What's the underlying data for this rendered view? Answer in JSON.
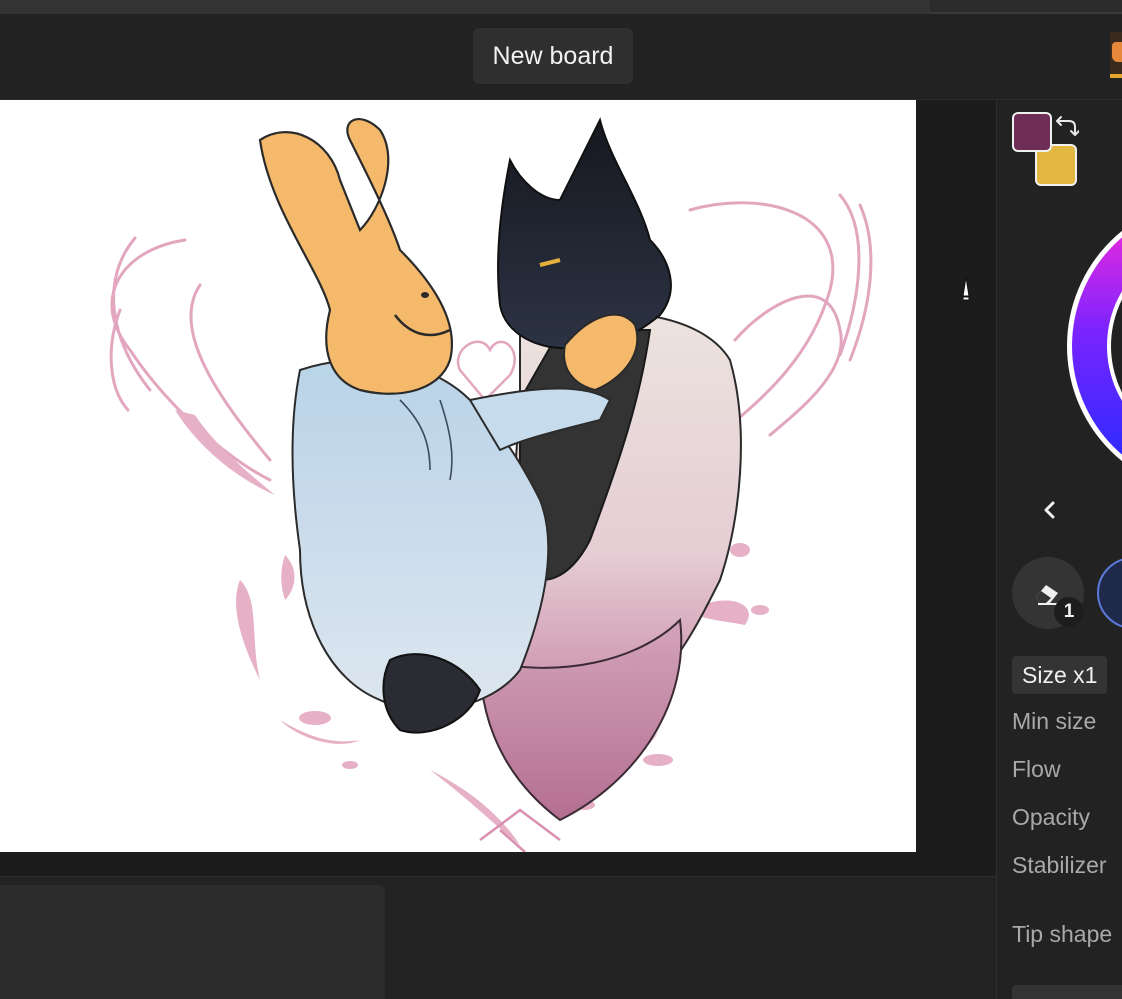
{
  "header": {
    "new_board_label": "New board"
  },
  "colors": {
    "primary": "#6e2e55",
    "secondary": "#e2b840",
    "accent": "#5b79d9"
  },
  "tools": {
    "eraser_badge": "1"
  },
  "brush_settings": {
    "size_label": "Size x1",
    "min_size_label": "Min size",
    "flow_label": "Flow",
    "opacity_label": "Opacity",
    "stabilizer_label": "Stabilizer",
    "tip_shape_label": "Tip shape"
  },
  "icons": {
    "swap": "swap-colors-icon",
    "chevron": "chevron-left-icon",
    "eraser": "eraser-icon",
    "cursor": "brush-cursor-icon"
  }
}
